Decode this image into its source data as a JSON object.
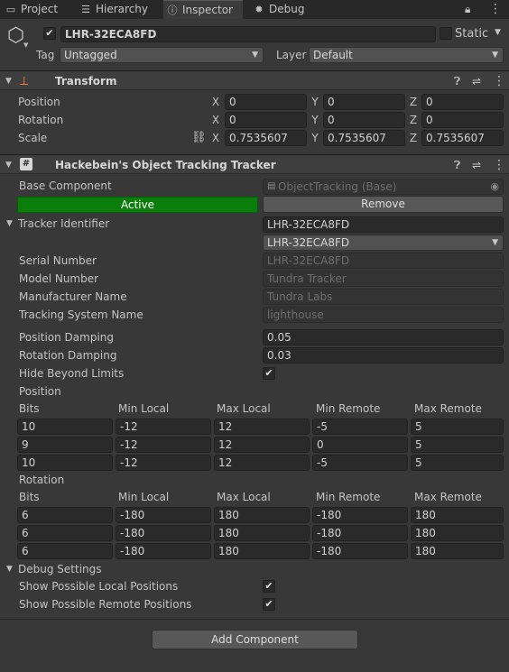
{
  "tabs": [
    {
      "label": "Project",
      "icon": "folder-icon",
      "glyph": "▭"
    },
    {
      "label": "Hierarchy",
      "icon": "list-icon",
      "glyph": "☰"
    },
    {
      "label": "Inspector",
      "icon": "info-icon",
      "glyph": "ⓘ"
    },
    {
      "label": "Debug",
      "icon": "bug-icon",
      "glyph": "✹"
    }
  ],
  "object": {
    "name": "LHR-32ECA8FD",
    "active": true,
    "static_label": "Static",
    "tag_label": "Tag",
    "tag_value": "Untagged",
    "layer_label": "Layer",
    "layer_value": "Default"
  },
  "transform": {
    "title": "Transform",
    "rows": [
      {
        "label": "Position",
        "x": "0",
        "y": "0",
        "z": "0"
      },
      {
        "label": "Rotation",
        "x": "0",
        "y": "0",
        "z": "0"
      },
      {
        "label": "Scale",
        "x": "0.7535607",
        "y": "0.7535607",
        "z": "0.7535607"
      }
    ],
    "axis": {
      "x": "X",
      "y": "Y",
      "z": "Z"
    }
  },
  "tracker": {
    "title": "Hackebein's Object Tracking Tracker",
    "base_component_label": "Base Component",
    "base_component_value": "ObjectTracking (Base)",
    "active_label": "Active",
    "remove_label": "Remove",
    "identifier_label": "Tracker Identifier",
    "identifier_value": "LHR-32ECA8FD",
    "identifier_dropdown": "LHR-32ECA8FD",
    "serial_label": "Serial Number",
    "serial_value": "LHR-32ECA8FD",
    "model_label": "Model Number",
    "model_value": "Tundra Tracker",
    "manufacturer_label": "Manufacturer Name",
    "manufacturer_value": "Tundra Labs",
    "tracking_system_label": "Tracking System Name",
    "tracking_system_value": "lighthouse",
    "pos_damping_label": "Position Damping",
    "pos_damping_value": "0.05",
    "rot_damping_label": "Rotation Damping",
    "rot_damping_value": "0.03",
    "hide_label": "Hide Beyond Limits",
    "hide_checked": true,
    "columns": [
      "Bits",
      "Min Local",
      "Max Local",
      "Min Remote",
      "Max Remote"
    ],
    "position_label": "Position",
    "position_rows": [
      [
        "10",
        "-12",
        "12",
        "-5",
        "5"
      ],
      [
        "9",
        "-12",
        "12",
        "0",
        "5"
      ],
      [
        "10",
        "-12",
        "12",
        "-5",
        "5"
      ]
    ],
    "rotation_label": "Rotation",
    "rotation_rows": [
      [
        "6",
        "-180",
        "180",
        "-180",
        "180"
      ],
      [
        "6",
        "-180",
        "180",
        "-180",
        "180"
      ],
      [
        "6",
        "-180",
        "180",
        "-180",
        "180"
      ]
    ],
    "debug_label": "Debug Settings",
    "show_local_label": "Show Possible Local Positions",
    "show_local_checked": true,
    "show_remote_label": "Show Possible Remote Positions",
    "show_remote_checked": true
  },
  "add_component_label": "Add Component",
  "colors": {
    "background": "#383838",
    "active_green": "#0a7d0a",
    "field": "#2a2a2a"
  }
}
